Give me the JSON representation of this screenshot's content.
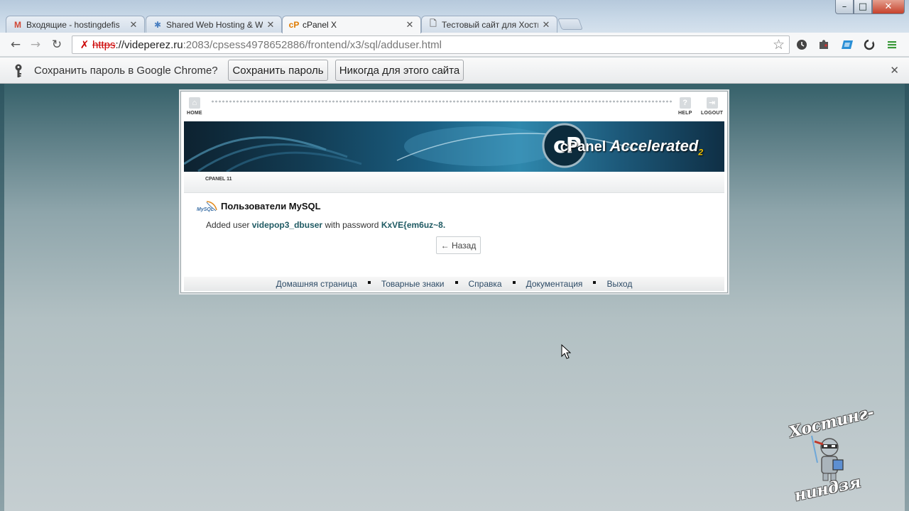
{
  "browser": {
    "tabs": [
      {
        "icon": "gmail-icon",
        "title": "Входящие - hostingdefis",
        "active": false
      },
      {
        "icon": "hosting-icon",
        "title": "Shared Web Hosting & W",
        "active": false
      },
      {
        "icon": "cpanel-icon",
        "title": "cPanel X",
        "active": true
      },
      {
        "icon": "page-icon",
        "title": "Тестовый сайт для Хости",
        "active": false
      }
    ],
    "url": {
      "scheme": "https",
      "host": "://videperez.ru",
      "path": ":2083/cpsess4978652886/frontend/x3/sql/adduser.html"
    }
  },
  "infobar": {
    "message": "Сохранить пароль в Google Chrome?",
    "save_label": "Сохранить пароль",
    "never_label": "Никогда для этого сайта"
  },
  "cpanel": {
    "nav": {
      "home": "HOME",
      "help": "HELP",
      "logout": "LOGOUT"
    },
    "brand": {
      "cp": "cPanel",
      "accel": "Accelerated",
      "num": "2"
    },
    "subtab": "CPANEL 11",
    "mysql_logo": "MySQL",
    "title": "Пользователи MySQL",
    "result": {
      "prefix": "Added user",
      "user": "videpop3_dbuser",
      "middle": "with password",
      "password": "KxVE{em6uz~8",
      "suffix": "."
    },
    "back_label": "← Назад",
    "footer": [
      "Домашняя страница",
      "Товарные знаки",
      "Справка",
      "Документация",
      "Выход"
    ]
  },
  "watermark": {
    "line1": "Хостинг-",
    "line2": "ниндзя"
  },
  "colors": {
    "accent_link": "#2d4b66",
    "result_value": "#1f5a63"
  }
}
